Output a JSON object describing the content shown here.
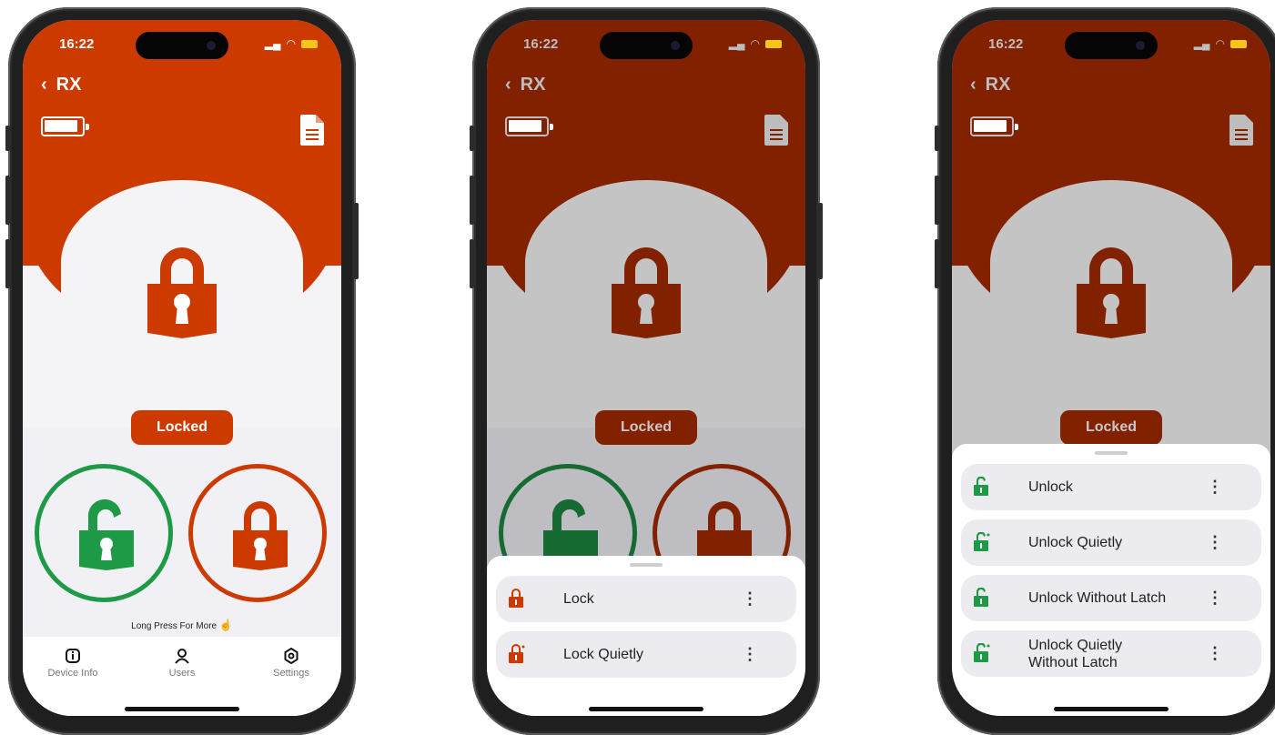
{
  "colors": {
    "accent_red": "#cc3a00",
    "dim_red": "#822100",
    "green": "#1e9a47"
  },
  "phone1": {
    "status": {
      "time": "16:22"
    },
    "nav": {
      "back_title": "RX"
    },
    "lock_status_label": "Locked",
    "hint": "Long Press For More",
    "tabs": [
      {
        "label": "Device Info",
        "icon": "info-icon"
      },
      {
        "label": "Users",
        "icon": "user-icon"
      },
      {
        "label": "Settings",
        "icon": "gear-icon"
      }
    ]
  },
  "phone2": {
    "status": {
      "time": "16:22"
    },
    "nav": {
      "back_title": "RX"
    },
    "lock_status_label": "Locked",
    "sheet_items": [
      {
        "label": "Lock",
        "icon": "lock-closed-icon"
      },
      {
        "label": "Lock Quietly",
        "icon": "lock-quiet-icon"
      }
    ]
  },
  "phone3": {
    "status": {
      "time": "16:22"
    },
    "nav": {
      "back_title": "RX"
    },
    "lock_status_label": "Locked",
    "sheet_items": [
      {
        "label": "Unlock",
        "icon": "lock-open-icon"
      },
      {
        "label": "Unlock Quietly",
        "icon": "lock-open-quiet-icon"
      },
      {
        "label": "Unlock Without Latch",
        "icon": "lock-open-icon"
      },
      {
        "label": "Unlock Quietly",
        "label2": "Without Latch",
        "icon": "lock-open-quiet-icon"
      }
    ]
  },
  "menu_more": "⋮"
}
